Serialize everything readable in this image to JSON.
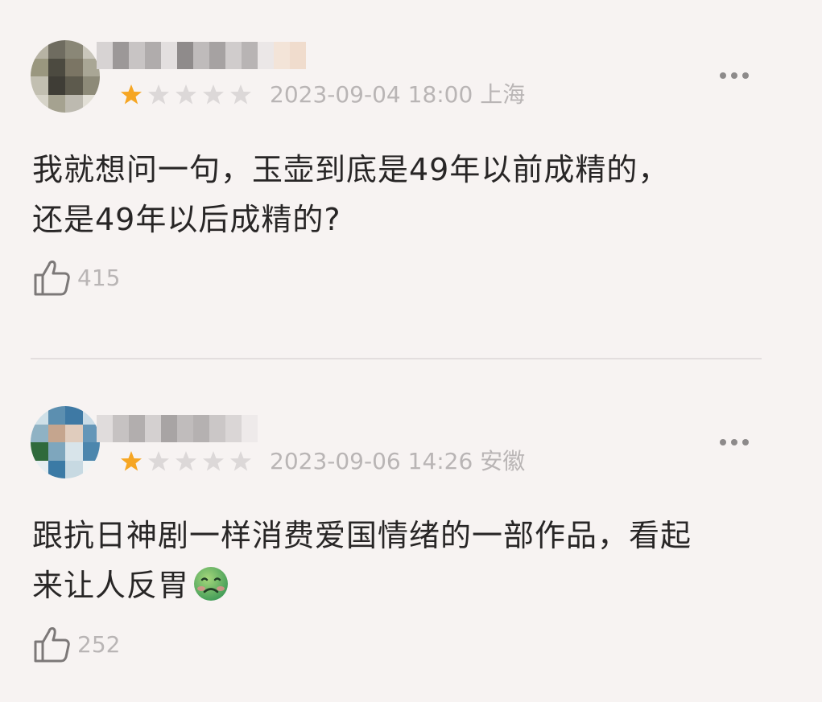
{
  "comments": [
    {
      "rating_stars": 1,
      "rating_max": 5,
      "date": "2023-09-04 18:00",
      "location": "上海",
      "text_lines": [
        "我就想问一句，玉壶到底是49年以前成精的，",
        "还是49年以后成精的?"
      ],
      "likes": "415",
      "emoji": null
    },
    {
      "rating_stars": 1,
      "rating_max": 5,
      "date": "2023-09-06 14:26",
      "location": "安徽",
      "text_lines": [
        "跟抗日神剧一样消费爱国情绪的一部作品，看起",
        "来让人反胃"
      ],
      "likes": "252",
      "emoji": "nauseated-face"
    }
  ],
  "colors": {
    "background": "#f7f3f2",
    "star_filled": "#f6a623",
    "star_empty": "#dcd8d8",
    "meta_text": "#b9b5b5",
    "body_text": "#282626",
    "divider": "#e3dede"
  }
}
